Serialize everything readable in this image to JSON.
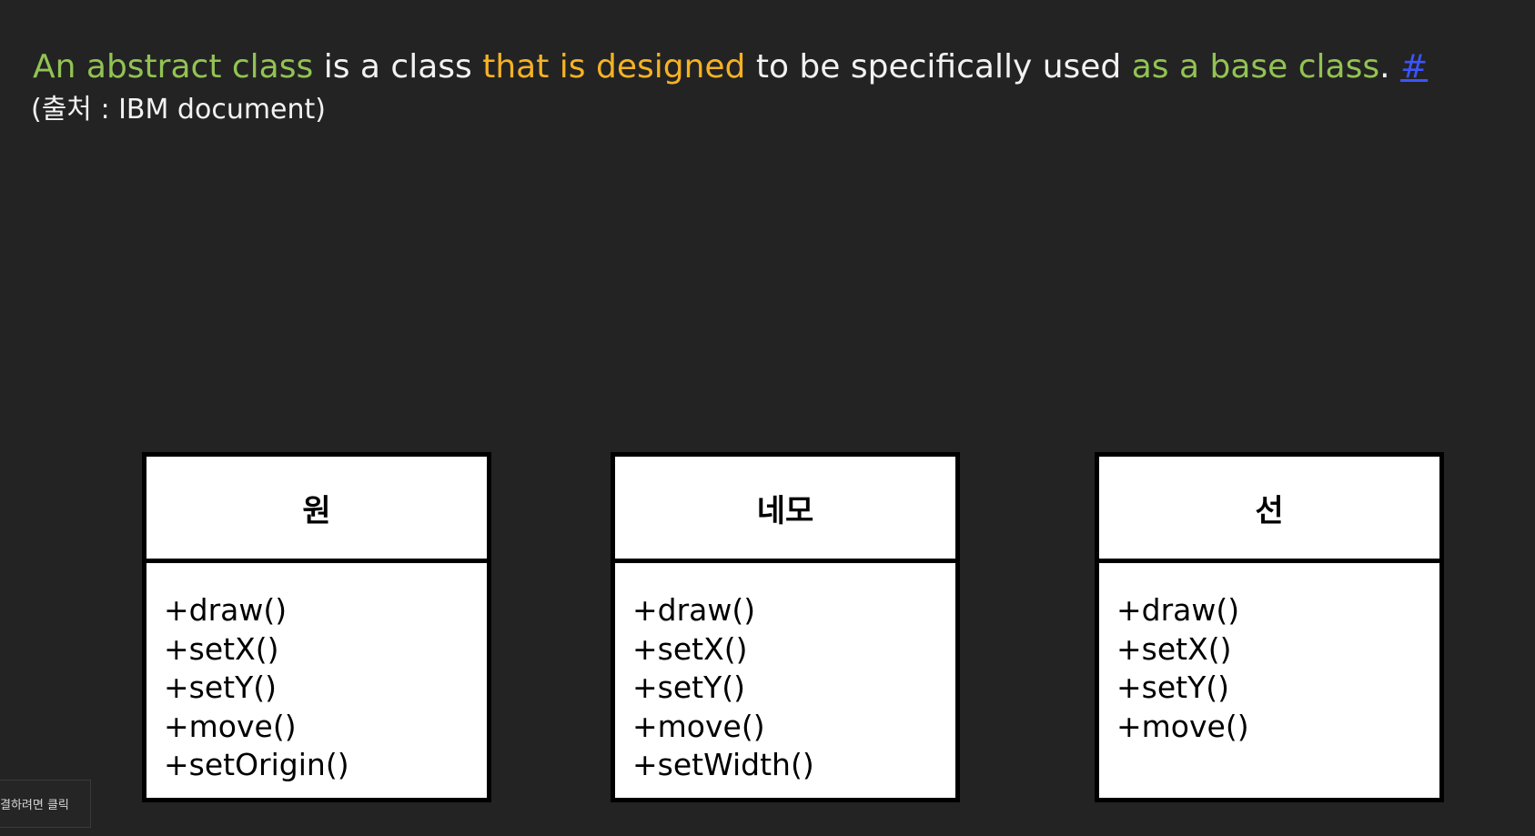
{
  "heading": {
    "part1": "An abstract class",
    "part2": " is a class ",
    "part3": "that is designed",
    "part4": " to be specifically used ",
    "part5": "as a base class",
    "part6": ". ",
    "link": "#"
  },
  "source": "(출처 : IBM document)",
  "colors": {
    "background": "#232323",
    "green": "#92c353",
    "orange": "#f5b225",
    "link": "#3b54ff"
  },
  "classes": [
    {
      "name": "원",
      "methods": [
        "+draw()",
        "+setX()",
        "+setY()",
        "+move()",
        "+setOrigin()"
      ]
    },
    {
      "name": "네모",
      "methods": [
        "+draw()",
        "+setX()",
        "+setY()",
        "+move()",
        "+setWidth()"
      ]
    },
    {
      "name": "선",
      "methods": [
        "+draw()",
        "+setX()",
        "+setY()",
        "+move()"
      ]
    }
  ],
  "tooltip": "결하려면 클릭"
}
